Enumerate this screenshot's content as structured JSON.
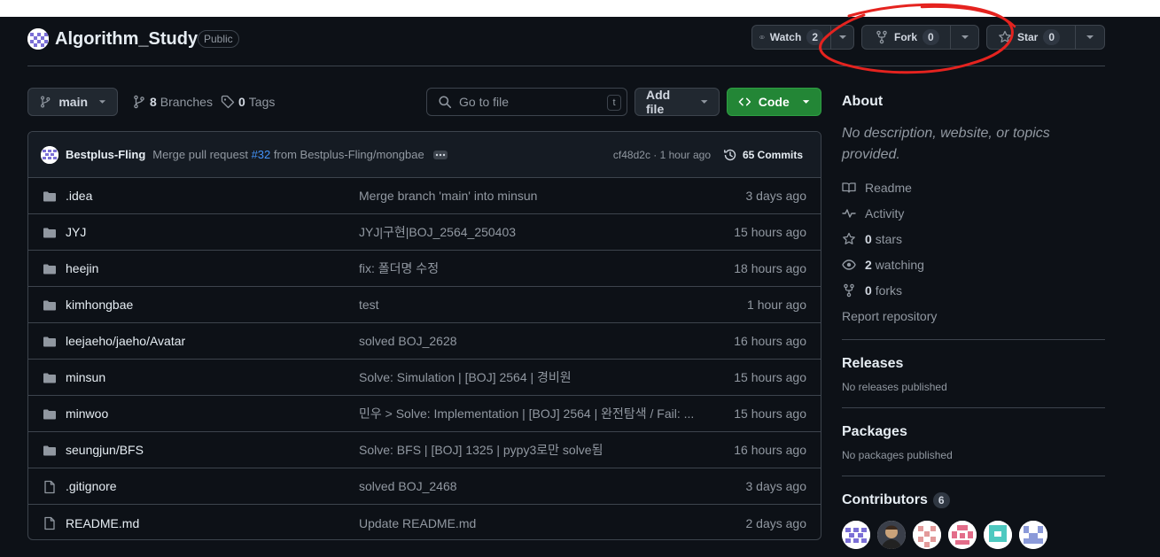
{
  "repo": {
    "name": "Algorithm_Study",
    "visibility": "Public"
  },
  "actions": {
    "watch_label": "Watch",
    "watch_count": "2",
    "fork_label": "Fork",
    "fork_count": "0",
    "star_label": "Star",
    "star_count": "0"
  },
  "toolbar": {
    "branch": "main",
    "branches_count": "8",
    "branches_label": "Branches",
    "tags_count": "0",
    "tags_label": "Tags",
    "search_placeholder": "Go to file",
    "search_shortcut": "t",
    "add_file_label": "Add file",
    "code_label": "Code"
  },
  "latest_commit": {
    "author": "Bestplus-Fling",
    "message_prefix": "Merge pull request",
    "pr": "#32",
    "message_suffix": "from Bestplus-Fling/mongbae",
    "meta": "cf48d2c · 1 hour ago",
    "commits_label": "65 Commits"
  },
  "files": [
    {
      "type": "folder",
      "name": ".idea",
      "commit": "Merge branch 'main' into minsun",
      "time": "3 days ago"
    },
    {
      "type": "folder",
      "name": "JYJ",
      "commit": "JYJ|구현|BOJ_2564_250403",
      "time": "15 hours ago"
    },
    {
      "type": "folder",
      "name": "heejin",
      "commit": "fix: 폴더명 수정",
      "time": "18 hours ago"
    },
    {
      "type": "folder",
      "name": "kimhongbae",
      "commit": "test",
      "time": "1 hour ago"
    },
    {
      "type": "folder",
      "name": "leejaeho/jaeho/Avatar",
      "commit": "solved BOJ_2628",
      "time": "16 hours ago"
    },
    {
      "type": "folder",
      "name": "minsun",
      "commit": "Solve: Simulation | [BOJ] 2564 | 경비원",
      "time": "15 hours ago"
    },
    {
      "type": "folder",
      "name": "minwoo",
      "commit": "민우 > Solve: Implementation | [BOJ] 2564 | 완전탐색 / Fail: ...",
      "time": "15 hours ago"
    },
    {
      "type": "folder",
      "name": "seungjun/BFS",
      "commit": "Solve: BFS | [BOJ] 1325 | pypy3로만 solve됨",
      "time": "16 hours ago"
    },
    {
      "type": "file",
      "name": ".gitignore",
      "commit": "solved BOJ_2468",
      "time": "3 days ago"
    },
    {
      "type": "file",
      "name": "README.md",
      "commit": "Update README.md",
      "time": "2 days ago"
    }
  ],
  "about": {
    "title": "About",
    "description": "No description, website, or topics provided.",
    "readme": "Readme",
    "activity": "Activity",
    "stars_count": "0",
    "stars_label": "stars",
    "watching_count": "2",
    "watching_label": "watching",
    "forks_count": "0",
    "forks_label": "forks",
    "report": "Report repository"
  },
  "releases": {
    "title": "Releases",
    "empty": "No releases published"
  },
  "packages": {
    "title": "Packages",
    "empty": "No packages published"
  },
  "contributors": {
    "title": "Contributors",
    "count": "6"
  },
  "colors": {
    "background": "#0d1117",
    "border": "#3d444d",
    "code_button": "#238636",
    "link": "#4493f8",
    "annotation": "#e5231f"
  }
}
